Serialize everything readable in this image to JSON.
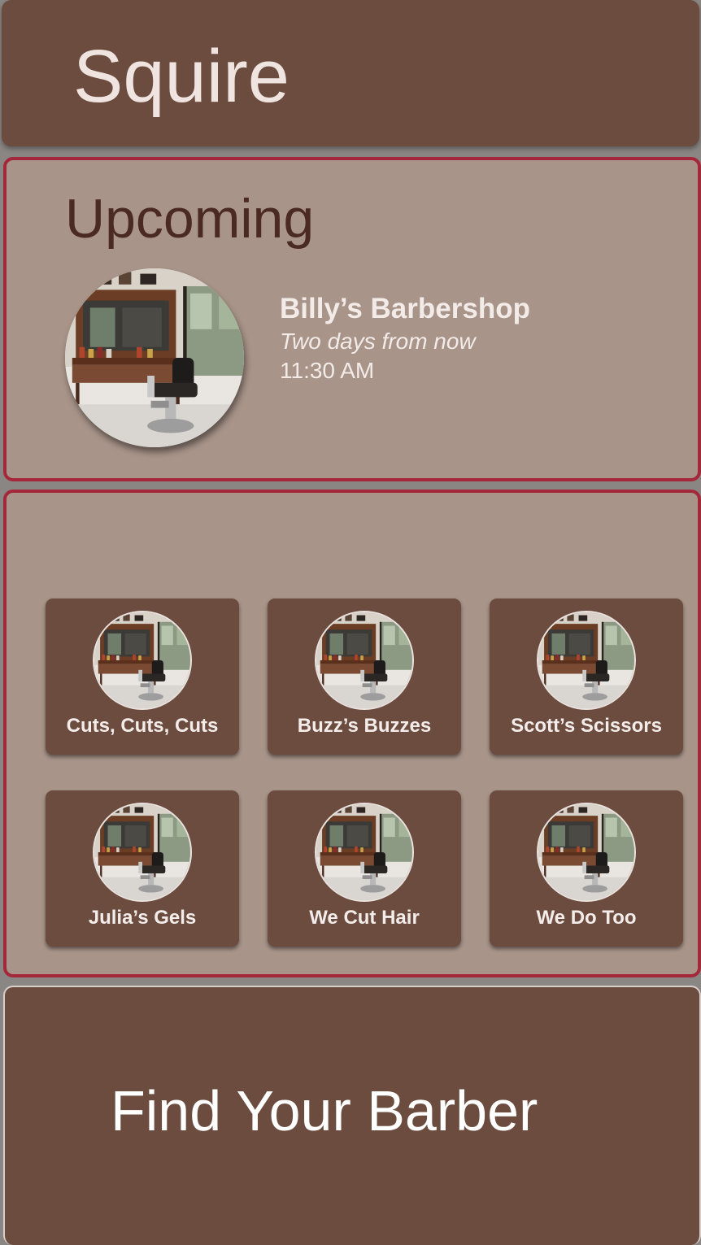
{
  "app": {
    "title": "Squire"
  },
  "upcoming": {
    "heading": "Upcoming",
    "shop_name": "Billy’s Barbershop",
    "when": "Two days from now",
    "time": "11:30 AM",
    "image_icon": "barbershop-photo"
  },
  "shops": [
    {
      "label": "Cuts, Cuts, Cuts"
    },
    {
      "label": "Buzz’s Buzzes"
    },
    {
      "label": "Scott’s Scissors"
    },
    {
      "label": "Julia’s Gels"
    },
    {
      "label": "We Cut Hair"
    },
    {
      "label": "We Do Too"
    }
  ],
  "cta": {
    "label": "Find Your Barber"
  },
  "colors": {
    "brown": "#6b4c3e",
    "panel": "#a89489",
    "accent_border": "#a5283a",
    "background": "#8a8684"
  }
}
